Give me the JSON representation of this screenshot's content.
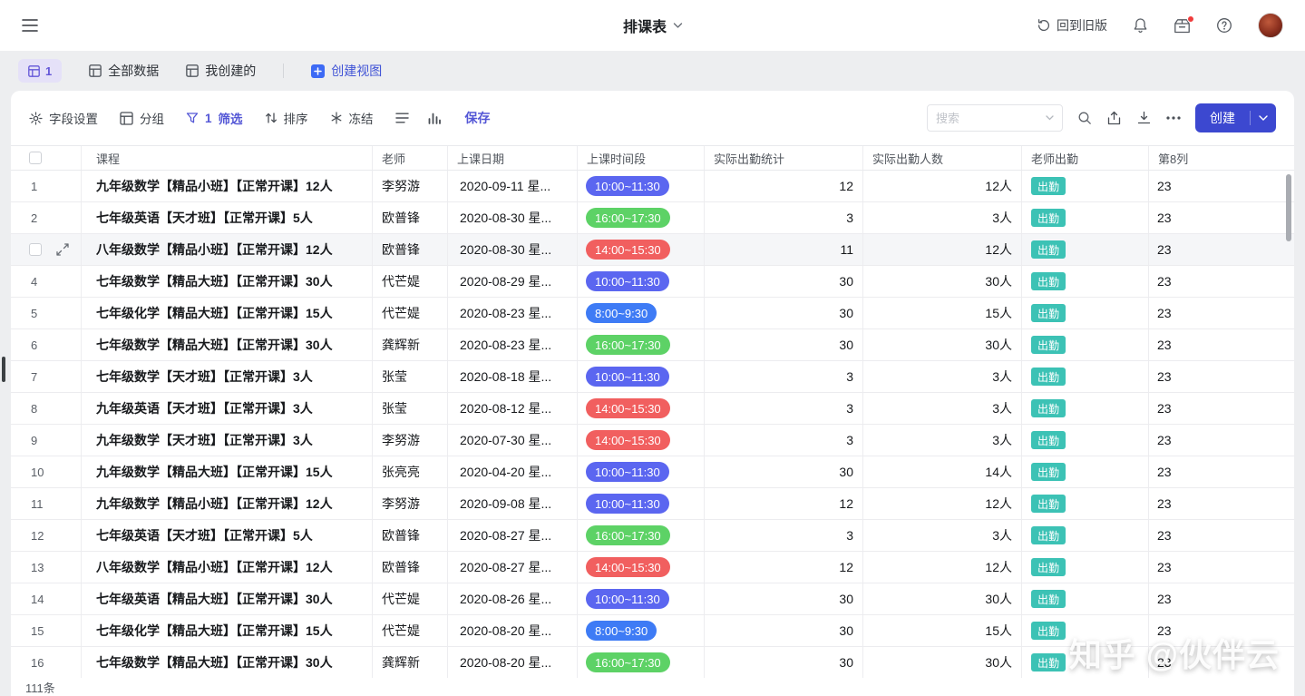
{
  "topbar": {
    "title": "排课表",
    "back_to_old_label": "回到旧版"
  },
  "view_tabs": {
    "active_tab_count": "1",
    "all_data_label": "全部数据",
    "my_created_label": "我创建的",
    "create_view_label": "创建视图"
  },
  "toolbar": {
    "field_settings_label": "字段设置",
    "group_label": "分组",
    "filter_count": "1",
    "filter_label": "筛选",
    "sort_label": "排序",
    "freeze_label": "冻结",
    "save_label": "保存",
    "search_placeholder": "搜索",
    "create_label": "创建"
  },
  "table": {
    "columns": {
      "course": "课程",
      "teacher": "老师",
      "date": "上课日期",
      "time": "上课时间段",
      "attendance_stat": "实际出勤统计",
      "attendance_count": "实际出勤人数",
      "teacher_attendance": "老师出勤",
      "col8": "第8列"
    },
    "attendance_badge": "出勤",
    "rows": [
      {
        "num": "1",
        "course": "九年级数学【精品小班】【正常开课】12人",
        "teacher": "李努游",
        "date": "2020-09-11 星...",
        "time": "10:00~11:30",
        "time_color": "indigo",
        "stat": "12",
        "count": "12人",
        "col8": "23"
      },
      {
        "num": "2",
        "course": "七年级英语【天才班】【正常开课】5人",
        "teacher": "欧普锋",
        "date": "2020-08-30 星...",
        "time": "16:00~17:30",
        "time_color": "green",
        "stat": "3",
        "count": "3人",
        "col8": "23"
      },
      {
        "num": "3",
        "course": "八年级数学【精品小班】【正常开课】12人",
        "teacher": "欧普锋",
        "date": "2020-08-30 星...",
        "time": "14:00~15:30",
        "time_color": "red",
        "stat": "11",
        "count": "12人",
        "col8": "23",
        "hovered": true
      },
      {
        "num": "4",
        "course": "七年级数学【精品大班】【正常开课】30人",
        "teacher": "代芒媞",
        "date": "2020-08-29 星...",
        "time": "10:00~11:30",
        "time_color": "indigo",
        "stat": "30",
        "count": "30人",
        "col8": "23"
      },
      {
        "num": "5",
        "course": "七年级化学【精品大班】【正常开课】15人",
        "teacher": "代芒媞",
        "date": "2020-08-23 星...",
        "time": "8:00~9:30",
        "time_color": "blue",
        "stat": "30",
        "count": "15人",
        "col8": "23"
      },
      {
        "num": "6",
        "course": "七年级数学【精品大班】【正常开课】30人",
        "teacher": "龚辉新",
        "date": "2020-08-23 星...",
        "time": "16:00~17:30",
        "time_color": "green",
        "stat": "30",
        "count": "30人",
        "col8": "23"
      },
      {
        "num": "7",
        "course": "七年级数学【天才班】【正常开课】3人",
        "teacher": "张莹",
        "date": "2020-08-18 星...",
        "time": "10:00~11:30",
        "time_color": "indigo",
        "stat": "3",
        "count": "3人",
        "col8": "23"
      },
      {
        "num": "8",
        "course": "九年级英语【天才班】【正常开课】3人",
        "teacher": "张莹",
        "date": "2020-08-12 星...",
        "time": "14:00~15:30",
        "time_color": "red",
        "stat": "3",
        "count": "3人",
        "col8": "23"
      },
      {
        "num": "9",
        "course": "九年级数学【天才班】【正常开课】3人",
        "teacher": "李努游",
        "date": "2020-07-30 星...",
        "time": "14:00~15:30",
        "time_color": "red",
        "stat": "3",
        "count": "3人",
        "col8": "23"
      },
      {
        "num": "10",
        "course": "九年级数学【精品大班】【正常开课】15人",
        "teacher": "张亮亮",
        "date": "2020-04-20 星...",
        "time": "10:00~11:30",
        "time_color": "indigo",
        "stat": "30",
        "count": "14人",
        "col8": "23"
      },
      {
        "num": "11",
        "course": "九年级数学【精品小班】【正常开课】12人",
        "teacher": "李努游",
        "date": "2020-09-08 星...",
        "time": "10:00~11:30",
        "time_color": "indigo",
        "stat": "12",
        "count": "12人",
        "col8": "23"
      },
      {
        "num": "12",
        "course": "七年级英语【天才班】【正常开课】5人",
        "teacher": "欧普锋",
        "date": "2020-08-27 星...",
        "time": "16:00~17:30",
        "time_color": "green",
        "stat": "3",
        "count": "3人",
        "col8": "23"
      },
      {
        "num": "13",
        "course": "八年级数学【精品小班】【正常开课】12人",
        "teacher": "欧普锋",
        "date": "2020-08-27 星...",
        "time": "14:00~15:30",
        "time_color": "red",
        "stat": "12",
        "count": "12人",
        "col8": "23"
      },
      {
        "num": "14",
        "course": "七年级英语【精品大班】【正常开课】30人",
        "teacher": "代芒媞",
        "date": "2020-08-26 星...",
        "time": "10:00~11:30",
        "time_color": "indigo",
        "stat": "30",
        "count": "30人",
        "col8": "23"
      },
      {
        "num": "15",
        "course": "七年级化学【精品大班】【正常开课】15人",
        "teacher": "代芒媞",
        "date": "2020-08-20 星...",
        "time": "8:00~9:30",
        "time_color": "blue",
        "stat": "30",
        "count": "15人",
        "col8": "23"
      },
      {
        "num": "16",
        "course": "七年级数学【精品大班】【正常开课】30人",
        "teacher": "龚辉新",
        "date": "2020-08-20 星...",
        "time": "16:00~17:30",
        "time_color": "green",
        "stat": "30",
        "count": "30人",
        "col8": "23"
      }
    ]
  },
  "footer": {
    "record_count": "111条"
  },
  "watermark": "知乎 @伙伴云",
  "colors": {
    "accent": "#3c48d0",
    "filter_active": "#5457d6",
    "attendance_badge_bg": "#3cc2b5",
    "time_colors": {
      "indigo": "#5b66f0",
      "green": "#5dd266",
      "red": "#f15f5f",
      "blue": "#3e7bf5"
    }
  }
}
